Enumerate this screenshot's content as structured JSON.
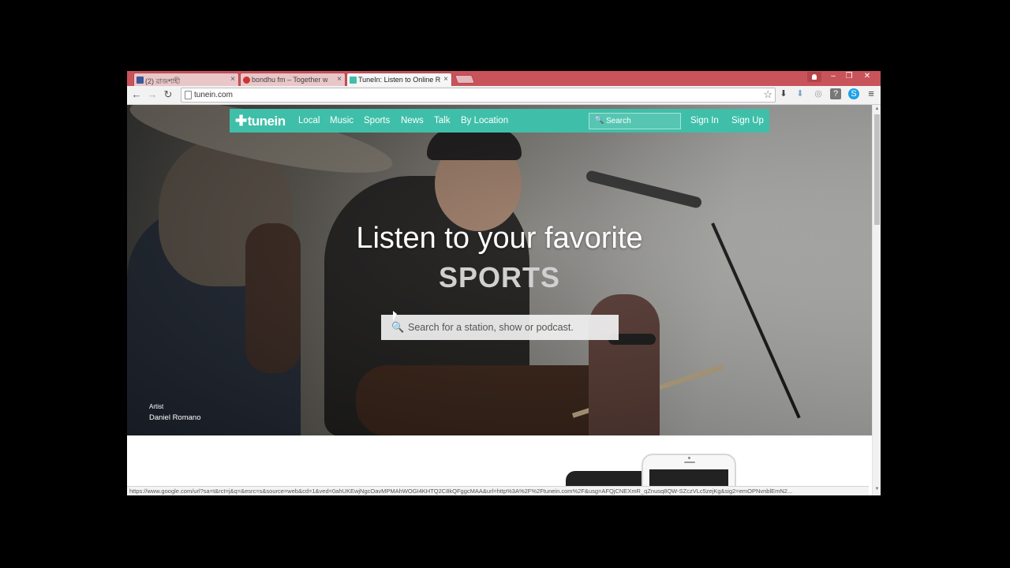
{
  "browser": {
    "tabs": [
      {
        "label": "(2) রাজশাহী",
        "favicon_color": "#3b5998"
      },
      {
        "label": "bondhu fm – Together w",
        "favicon_color": "#cc3333"
      },
      {
        "label": "TuneIn: Listen to Online R",
        "favicon_color": "#3fbfa9"
      }
    ],
    "tab_close": "×",
    "window_controls": {
      "minimize": "–",
      "restore": "❐",
      "close": "✕"
    },
    "url": "tunein.com",
    "status_url": "https://www.google.com/url?sa=t&rct=j&q=&esrc=s&source=web&cd=1&ved=0ahUKEwjNgcOavMPMAhWOGI4KHTQ2C8kQFggcMAA&url=http%3A%2F%2Ftunein.com%2F&usg=AFQjCNEXmR_qZnusq8QW-SZczVLc5zejKg&sig2=emOPNvnblEmN2..."
  },
  "site": {
    "logo": "tunein",
    "nav": [
      "Local",
      "Music",
      "Sports",
      "News",
      "Talk",
      "By Location"
    ],
    "search_placeholder": "Search",
    "sign_in": "Sign In",
    "separator": "·",
    "sign_up": "Sign Up",
    "accent": "#3fbfa9"
  },
  "hero": {
    "headline": "Listen to your favorite",
    "category": "SPORTS",
    "search_placeholder": "Search for a station, show or podcast.",
    "credit_label": "Artist",
    "credit_name": "Daniel Romano"
  }
}
